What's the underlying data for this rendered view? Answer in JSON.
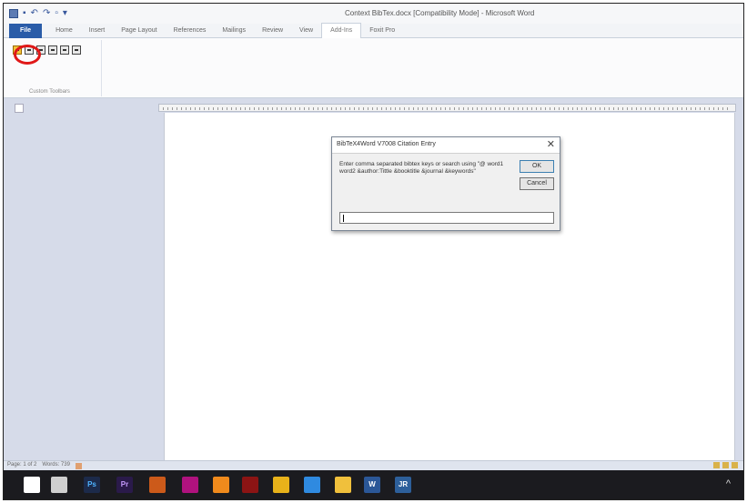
{
  "window": {
    "title": "Context BibTex.docx [Compatibility Mode] - Microsoft Word"
  },
  "quick_access": [
    "save-icon",
    "undo-icon",
    "redo-icon",
    "print-icon"
  ],
  "ribbon": {
    "tabs": [
      "File",
      "Home",
      "Insert",
      "Page Layout",
      "References",
      "Mailings",
      "Review",
      "View",
      "Add-Ins",
      "Foxit Pro"
    ],
    "active_tab": "Add-Ins",
    "group_label": "Custom Toolbars",
    "toolbar_buttons": [
      "insert-citation-icon",
      "toggle-icon",
      "first-icon",
      "edit-icon",
      "next-icon",
      "bibliography-icon"
    ]
  },
  "dialog": {
    "title": "BibTeX4Word V7008 Citation Entry",
    "prompt": "Enter comma separated bibtex keys or search using \"@ word1 word2 &author:Tittle &booktitle &journal &keywords\"",
    "ok_label": "OK",
    "cancel_label": "Cancel",
    "input_value": ""
  },
  "statusbar": {
    "page": "Page: 1 of 2",
    "words": "Words: 739"
  },
  "taskbar": {
    "apps": [
      {
        "name": "start",
        "label": "",
        "color": "#ffffff",
        "text": "#1b1b1f"
      },
      {
        "name": "task-view",
        "label": "",
        "color": "#cfcfcf",
        "text": "#1b1b1f"
      },
      {
        "name": "photoshop",
        "label": "Ps",
        "color": "#1c2a4a",
        "text": "#4fb3ff"
      },
      {
        "name": "premiere",
        "label": "Pr",
        "color": "#2a1a4a",
        "text": "#c79bff"
      },
      {
        "name": "aftereffects-files",
        "label": "",
        "color": "#cc5a1a",
        "text": "#ffffff"
      },
      {
        "name": "adobe-media",
        "label": "",
        "color": "#b0127e",
        "text": "#ffffff"
      },
      {
        "name": "vlc",
        "label": "",
        "color": "#f08a1c",
        "text": "#ffffff"
      },
      {
        "name": "acrobat",
        "label": "",
        "color": "#8c1414",
        "text": "#ffffff"
      },
      {
        "name": "chrome",
        "label": "",
        "color": "#e8b21a",
        "text": "#ffffff"
      },
      {
        "name": "visual-studio",
        "label": "",
        "color": "#2f8ae0",
        "text": "#ffffff"
      },
      {
        "name": "file-explorer",
        "label": "",
        "color": "#f0c03c",
        "text": "#ffffff"
      },
      {
        "name": "word",
        "label": "W",
        "color": "#2b5797",
        "text": "#ffffff"
      },
      {
        "name": "jabref",
        "label": "JR",
        "color": "#2d5f9a",
        "text": "#ffffff"
      }
    ]
  }
}
